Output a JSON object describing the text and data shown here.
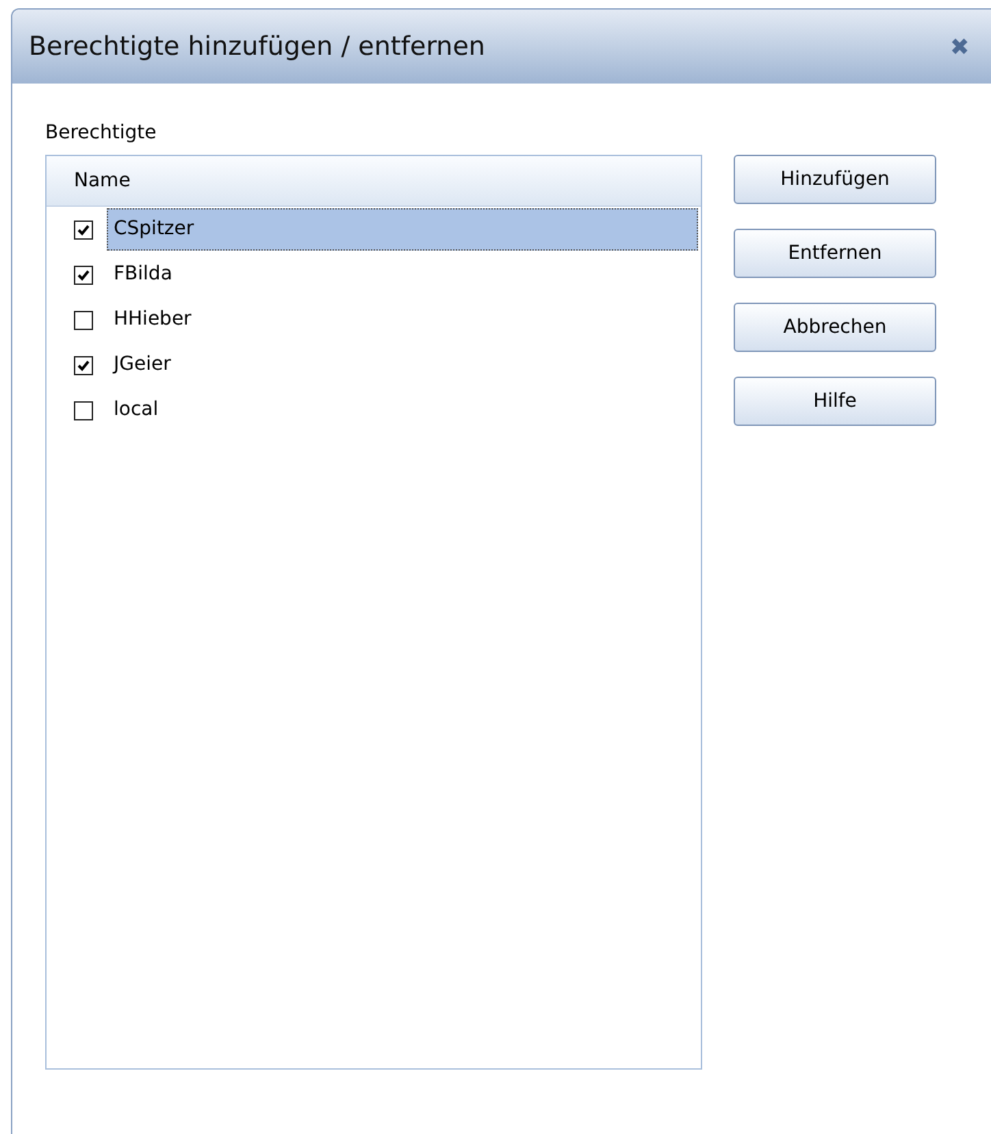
{
  "window": {
    "title": "Berechtigte hinzufügen / entfernen",
    "close": "✖"
  },
  "group_label": "Berechtigte",
  "list": {
    "columns": [
      "Name"
    ],
    "rows": [
      {
        "name": "CSpitzer",
        "checked": true,
        "selected": true
      },
      {
        "name": "FBilda",
        "checked": true,
        "selected": false
      },
      {
        "name": "HHieber",
        "checked": false,
        "selected": false
      },
      {
        "name": "JGeier",
        "checked": true,
        "selected": false
      },
      {
        "name": "local",
        "checked": false,
        "selected": false
      }
    ]
  },
  "buttons": [
    "Hinzufügen",
    "Entfernen",
    "Abbrechen",
    "Hilfe"
  ]
}
